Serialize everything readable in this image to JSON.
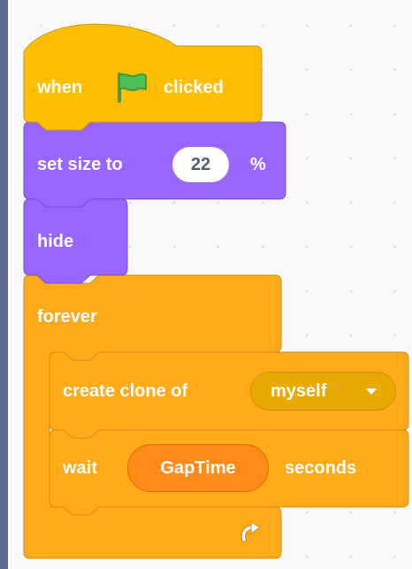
{
  "blocks": {
    "hat": {
      "text_when": "when",
      "flag_icon": "green-flag-icon",
      "text_clicked": "clicked",
      "color": "#ffbf00"
    },
    "set_size": {
      "text": "set size to",
      "value": "22",
      "unit": "%",
      "color": "#9966ff"
    },
    "hide": {
      "text": "hide",
      "color": "#9966ff"
    },
    "forever": {
      "text": "forever",
      "loop_icon": "loop-arrow-icon",
      "color": "#ffab19"
    },
    "create_clone": {
      "text": "create clone of",
      "option": "myself",
      "dropdown_icon": "caret-down-icon"
    },
    "wait": {
      "text_wait": "wait",
      "variable": "GapTime",
      "text_seconds": "seconds",
      "variable_color": "#ff8c1a"
    }
  }
}
